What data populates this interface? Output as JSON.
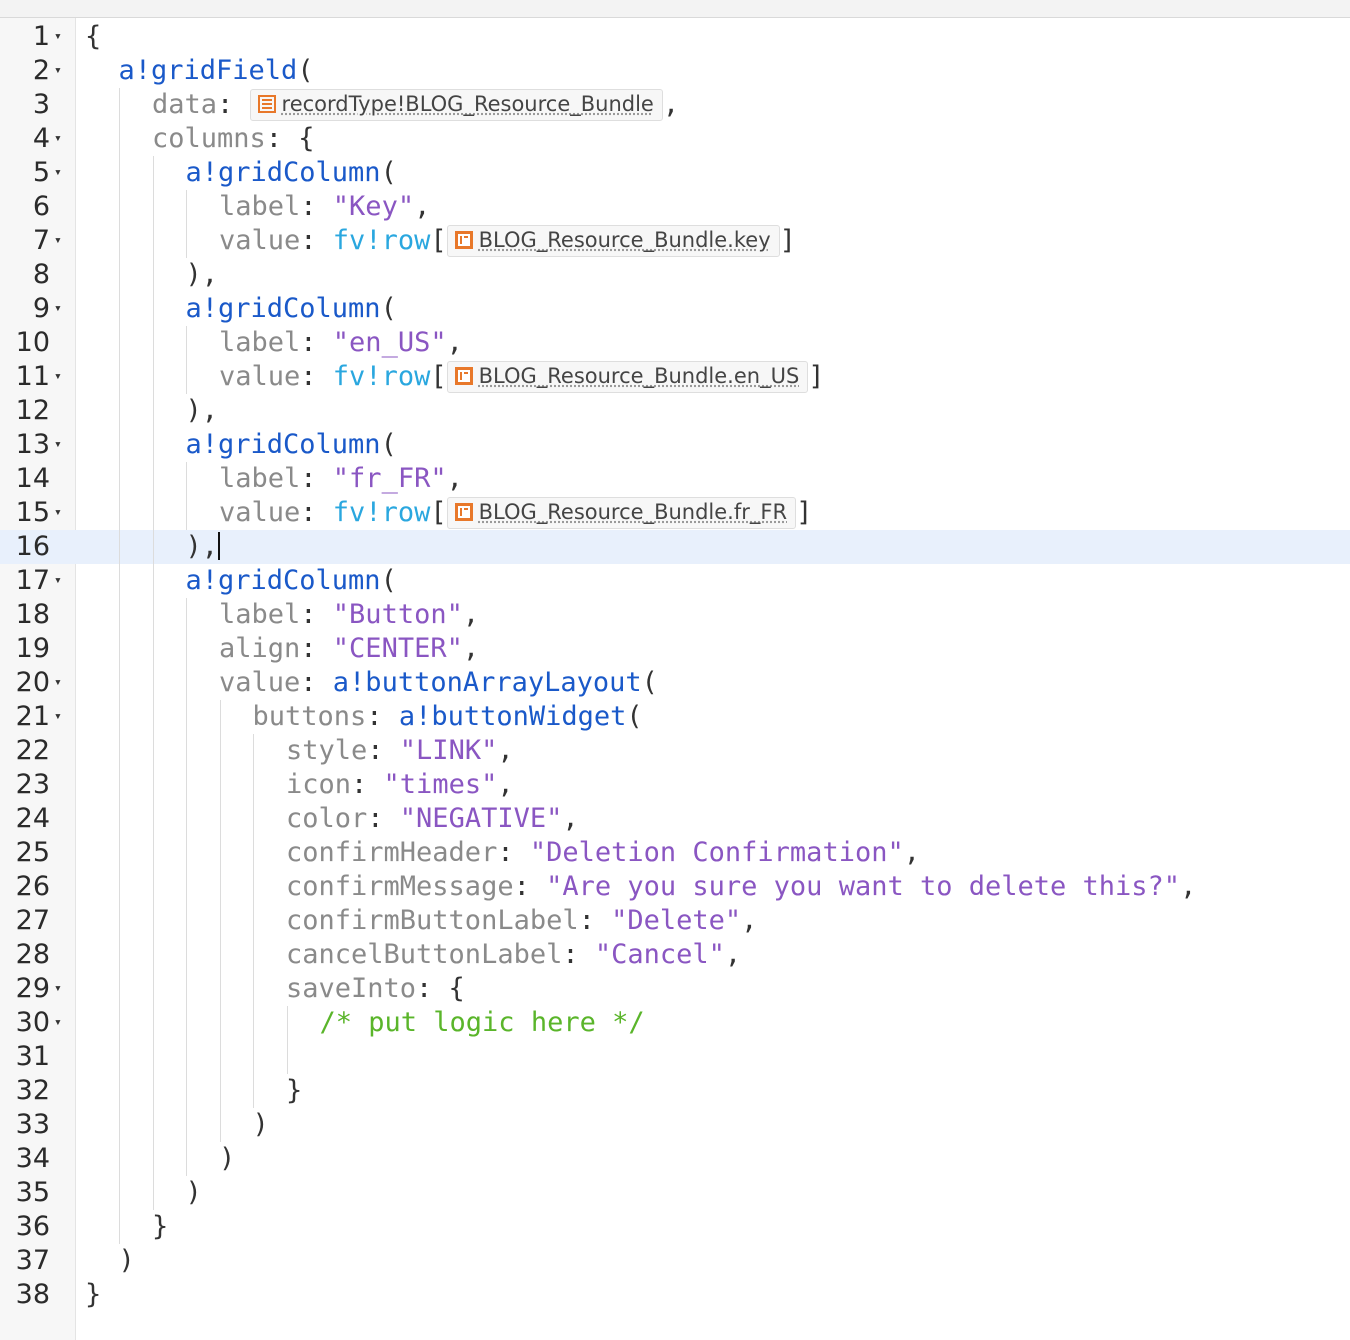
{
  "editor": {
    "lines": [
      {
        "n": "1",
        "fold": true,
        "indent": 0,
        "tokens": [
          {
            "c": "punc",
            "t": "{"
          }
        ]
      },
      {
        "n": "2",
        "fold": true,
        "indent": 1,
        "tokens": [
          {
            "c": "fn",
            "t": "a!gridField"
          },
          {
            "c": "punc",
            "t": "("
          }
        ]
      },
      {
        "n": "3",
        "fold": false,
        "indent": 2,
        "tokens": [
          {
            "c": "key",
            "t": "data"
          },
          {
            "c": "punc",
            "t": ": "
          },
          {
            "chip": "record",
            "t": "recordType!BLOG_Resource_Bundle"
          },
          {
            "c": "punc",
            "t": ","
          }
        ]
      },
      {
        "n": "4",
        "fold": true,
        "indent": 2,
        "tokens": [
          {
            "c": "key",
            "t": "columns"
          },
          {
            "c": "punc",
            "t": ": {"
          }
        ]
      },
      {
        "n": "5",
        "fold": true,
        "indent": 3,
        "tokens": [
          {
            "c": "fn",
            "t": "a!gridColumn"
          },
          {
            "c": "punc",
            "t": "("
          }
        ]
      },
      {
        "n": "6",
        "fold": false,
        "indent": 4,
        "tokens": [
          {
            "c": "key",
            "t": "label"
          },
          {
            "c": "punc",
            "t": ": "
          },
          {
            "c": "str",
            "t": "\"Key\""
          },
          {
            "c": "punc",
            "t": ","
          }
        ]
      },
      {
        "n": "7",
        "fold": true,
        "indent": 4,
        "tokens": [
          {
            "c": "key",
            "t": "value"
          },
          {
            "c": "punc",
            "t": ": "
          },
          {
            "c": "fv",
            "t": "fv!row"
          },
          {
            "c": "punc",
            "t": "["
          },
          {
            "chip": "field",
            "t": "BLOG_Resource_Bundle.key"
          },
          {
            "c": "punc",
            "t": "]"
          }
        ]
      },
      {
        "n": "8",
        "fold": false,
        "indent": 3,
        "tokens": [
          {
            "c": "punc",
            "t": "),"
          }
        ]
      },
      {
        "n": "9",
        "fold": true,
        "indent": 3,
        "tokens": [
          {
            "c": "fn",
            "t": "a!gridColumn"
          },
          {
            "c": "punc",
            "t": "("
          }
        ]
      },
      {
        "n": "10",
        "fold": false,
        "indent": 4,
        "tokens": [
          {
            "c": "key",
            "t": "label"
          },
          {
            "c": "punc",
            "t": ": "
          },
          {
            "c": "str",
            "t": "\"en_US\""
          },
          {
            "c": "punc",
            "t": ","
          }
        ]
      },
      {
        "n": "11",
        "fold": true,
        "indent": 4,
        "tokens": [
          {
            "c": "key",
            "t": "value"
          },
          {
            "c": "punc",
            "t": ": "
          },
          {
            "c": "fv",
            "t": "fv!row"
          },
          {
            "c": "punc",
            "t": "["
          },
          {
            "chip": "field",
            "t": "BLOG_Resource_Bundle.en_US"
          },
          {
            "c": "punc",
            "t": "]"
          }
        ]
      },
      {
        "n": "12",
        "fold": false,
        "indent": 3,
        "tokens": [
          {
            "c": "punc",
            "t": "),"
          }
        ]
      },
      {
        "n": "13",
        "fold": true,
        "indent": 3,
        "tokens": [
          {
            "c": "fn",
            "t": "a!gridColumn"
          },
          {
            "c": "punc",
            "t": "("
          }
        ]
      },
      {
        "n": "14",
        "fold": false,
        "indent": 4,
        "tokens": [
          {
            "c": "key",
            "t": "label"
          },
          {
            "c": "punc",
            "t": ": "
          },
          {
            "c": "str",
            "t": "\"fr_FR\""
          },
          {
            "c": "punc",
            "t": ","
          }
        ]
      },
      {
        "n": "15",
        "fold": true,
        "indent": 4,
        "tokens": [
          {
            "c": "key",
            "t": "value"
          },
          {
            "c": "punc",
            "t": ": "
          },
          {
            "c": "fv",
            "t": "fv!row"
          },
          {
            "c": "punc",
            "t": "["
          },
          {
            "chip": "field",
            "t": "BLOG_Resource_Bundle.fr_FR"
          },
          {
            "c": "punc",
            "t": "]"
          }
        ]
      },
      {
        "n": "16",
        "fold": false,
        "indent": 3,
        "active": true,
        "tokens": [
          {
            "c": "punc",
            "t": "),"
          }
        ]
      },
      {
        "n": "17",
        "fold": true,
        "indent": 3,
        "tokens": [
          {
            "c": "fn",
            "t": "a!gridColumn"
          },
          {
            "c": "punc",
            "t": "("
          }
        ]
      },
      {
        "n": "18",
        "fold": false,
        "indent": 4,
        "tokens": [
          {
            "c": "key",
            "t": "label"
          },
          {
            "c": "punc",
            "t": ": "
          },
          {
            "c": "str",
            "t": "\"Button\""
          },
          {
            "c": "punc",
            "t": ","
          }
        ]
      },
      {
        "n": "19",
        "fold": false,
        "indent": 4,
        "tokens": [
          {
            "c": "key",
            "t": "align"
          },
          {
            "c": "punc",
            "t": ": "
          },
          {
            "c": "str",
            "t": "\"CENTER\""
          },
          {
            "c": "punc",
            "t": ","
          }
        ]
      },
      {
        "n": "20",
        "fold": true,
        "indent": 4,
        "tokens": [
          {
            "c": "key",
            "t": "value"
          },
          {
            "c": "punc",
            "t": ": "
          },
          {
            "c": "fn",
            "t": "a!buttonArrayLayout"
          },
          {
            "c": "punc",
            "t": "("
          }
        ]
      },
      {
        "n": "21",
        "fold": true,
        "indent": 5,
        "tokens": [
          {
            "c": "key",
            "t": "buttons"
          },
          {
            "c": "punc",
            "t": ": "
          },
          {
            "c": "fn",
            "t": "a!buttonWidget"
          },
          {
            "c": "punc",
            "t": "("
          }
        ]
      },
      {
        "n": "22",
        "fold": false,
        "indent": 6,
        "tokens": [
          {
            "c": "key",
            "t": "style"
          },
          {
            "c": "punc",
            "t": ": "
          },
          {
            "c": "str",
            "t": "\"LINK\""
          },
          {
            "c": "punc",
            "t": ","
          }
        ]
      },
      {
        "n": "23",
        "fold": false,
        "indent": 6,
        "tokens": [
          {
            "c": "key",
            "t": "icon"
          },
          {
            "c": "punc",
            "t": ": "
          },
          {
            "c": "str",
            "t": "\"times\""
          },
          {
            "c": "punc",
            "t": ","
          }
        ]
      },
      {
        "n": "24",
        "fold": false,
        "indent": 6,
        "tokens": [
          {
            "c": "key",
            "t": "color"
          },
          {
            "c": "punc",
            "t": ": "
          },
          {
            "c": "str",
            "t": "\"NEGATIVE\""
          },
          {
            "c": "punc",
            "t": ","
          }
        ]
      },
      {
        "n": "25",
        "fold": false,
        "indent": 6,
        "tokens": [
          {
            "c": "key",
            "t": "confirmHeader"
          },
          {
            "c": "punc",
            "t": ": "
          },
          {
            "c": "str",
            "t": "\"Deletion Confirmation\""
          },
          {
            "c": "punc",
            "t": ","
          }
        ]
      },
      {
        "n": "26",
        "fold": false,
        "indent": 6,
        "tokens": [
          {
            "c": "key",
            "t": "confirmMessage"
          },
          {
            "c": "punc",
            "t": ": "
          },
          {
            "c": "str",
            "t": "\"Are you sure you want to delete this?\""
          },
          {
            "c": "punc",
            "t": ","
          }
        ]
      },
      {
        "n": "27",
        "fold": false,
        "indent": 6,
        "tokens": [
          {
            "c": "key",
            "t": "confirmButtonLabel"
          },
          {
            "c": "punc",
            "t": ": "
          },
          {
            "c": "str",
            "t": "\"Delete\""
          },
          {
            "c": "punc",
            "t": ","
          }
        ]
      },
      {
        "n": "28",
        "fold": false,
        "indent": 6,
        "tokens": [
          {
            "c": "key",
            "t": "cancelButtonLabel"
          },
          {
            "c": "punc",
            "t": ": "
          },
          {
            "c": "str",
            "t": "\"Cancel\""
          },
          {
            "c": "punc",
            "t": ","
          }
        ]
      },
      {
        "n": "29",
        "fold": true,
        "indent": 6,
        "tokens": [
          {
            "c": "key",
            "t": "saveInto"
          },
          {
            "c": "punc",
            "t": ": {"
          }
        ]
      },
      {
        "n": "30",
        "fold": true,
        "indent": 7,
        "tokens": [
          {
            "c": "comment",
            "t": "/* put logic here */"
          }
        ]
      },
      {
        "n": "31",
        "fold": false,
        "indent": 7,
        "tokens": []
      },
      {
        "n": "32",
        "fold": false,
        "indent": 6,
        "tokens": [
          {
            "c": "punc",
            "t": "}"
          }
        ]
      },
      {
        "n": "33",
        "fold": false,
        "indent": 5,
        "tokens": [
          {
            "c": "punc",
            "t": ")"
          }
        ]
      },
      {
        "n": "34",
        "fold": false,
        "indent": 4,
        "tokens": [
          {
            "c": "punc",
            "t": ")"
          }
        ]
      },
      {
        "n": "35",
        "fold": false,
        "indent": 3,
        "tokens": [
          {
            "c": "punc",
            "t": ")"
          }
        ]
      },
      {
        "n": "36",
        "fold": false,
        "indent": 2,
        "tokens": [
          {
            "c": "punc",
            "t": "}"
          }
        ]
      },
      {
        "n": "37",
        "fold": false,
        "indent": 1,
        "tokens": [
          {
            "c": "punc",
            "t": ")"
          }
        ]
      },
      {
        "n": "38",
        "fold": false,
        "indent": 0,
        "tokens": [
          {
            "c": "punc",
            "t": "}"
          }
        ]
      }
    ],
    "fold_glyph": "▾"
  },
  "colors": {
    "function": "#1a59c9",
    "parameter": "#8a8a8a",
    "string": "#8a56c2",
    "function_variable": "#2aa7df",
    "comment": "#5ab52a",
    "chip_icon": "#e8782a",
    "active_line": "#e8f0fc"
  }
}
